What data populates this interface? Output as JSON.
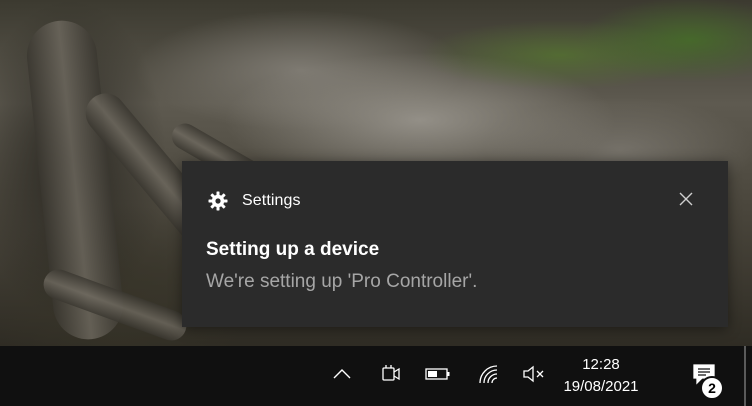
{
  "toast": {
    "app_name": "Settings",
    "app_icon": "gear-icon",
    "close_icon": "close-icon",
    "title": "Setting up a device",
    "body": "We're setting up 'Pro Controller'."
  },
  "taskbar": {
    "tray_icons": [
      "chevron-up-icon",
      "meet-now-icon",
      "battery-icon",
      "wifi-icon",
      "volume-muted-icon"
    ],
    "time": "12:28",
    "date": "19/08/2021",
    "notification_count": "2",
    "notification_icon": "action-center-icon"
  },
  "colors": {
    "toast_bg": "#2b2b2b",
    "toast_text": "#ffffff",
    "toast_secondary": "#a6a6a6",
    "taskbar_bg": "#101010"
  }
}
